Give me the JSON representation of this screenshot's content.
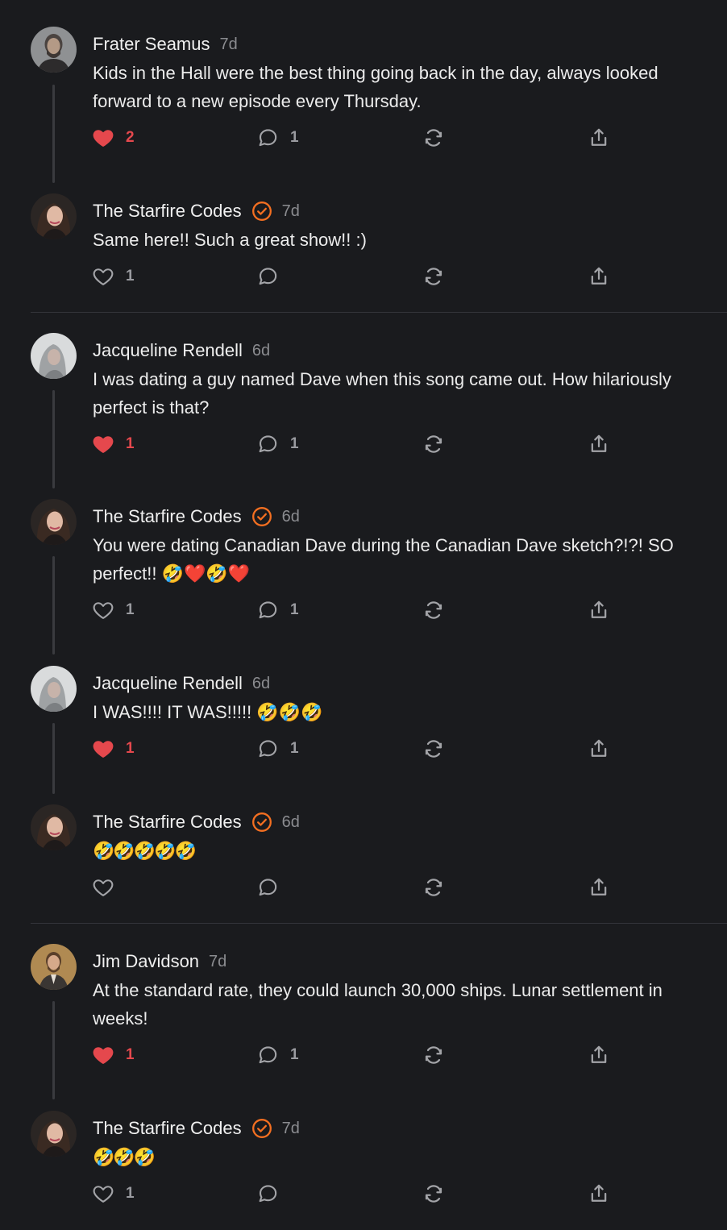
{
  "colors": {
    "accent": "#f36f21",
    "like": "#e5484d",
    "background": "#1a1b1e"
  },
  "icons": {
    "like": "heart-icon",
    "reply": "comment-bubble-icon",
    "restack": "restack-icon",
    "share": "share-icon",
    "verified": "verified-check-icon"
  },
  "comments": [
    {
      "author": "Frater Seamus",
      "time": "7d",
      "text": "Kids in the Hall were the best thing going back in the day, always looked forward to a new episode every Thursday.",
      "likes": "2",
      "liked": true,
      "replies": "1"
    },
    {
      "author": "The Starfire Codes",
      "time": "7d",
      "text": "Same here!! Such a great show!! :)",
      "likes": "1",
      "liked": false,
      "replies": ""
    },
    {
      "author": "Jacqueline Rendell",
      "time": "6d",
      "text": "I was dating a guy named Dave when this song came out. How hilariously perfect is that?",
      "likes": "1",
      "liked": true,
      "replies": "1"
    },
    {
      "author": "The Starfire Codes",
      "time": "6d",
      "text": "You were dating Canadian Dave during the Canadian Dave sketch?!?! SO perfect!! 🤣❤️🤣❤️",
      "likes": "1",
      "liked": false,
      "replies": "1"
    },
    {
      "author": "Jacqueline Rendell",
      "time": "6d",
      "text": "I WAS!!!! IT WAS!!!!! 🤣🤣🤣",
      "likes": "1",
      "liked": true,
      "replies": "1"
    },
    {
      "author": "The Starfire Codes",
      "time": "6d",
      "text": "🤣🤣🤣🤣🤣",
      "likes": "",
      "liked": false,
      "replies": ""
    },
    {
      "author": "Jim Davidson",
      "time": "7d",
      "text": "At the standard rate, they could launch 30,000 ships. Lunar settlement in weeks!",
      "likes": "1",
      "liked": true,
      "replies": "1"
    },
    {
      "author": "The Starfire Codes",
      "time": "7d",
      "text": "🤣🤣🤣",
      "likes": "1",
      "liked": false,
      "replies": ""
    }
  ]
}
